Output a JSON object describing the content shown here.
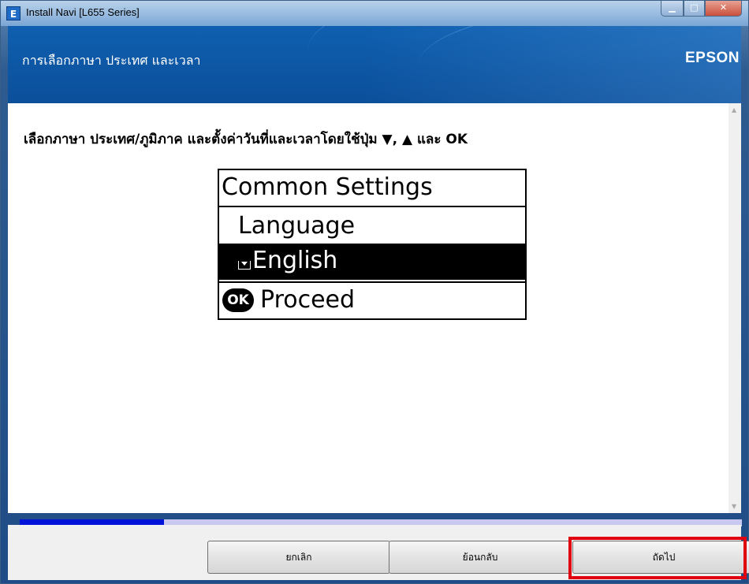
{
  "window": {
    "title": "Install Navi [L655 Series]",
    "app_icon_letter": "E"
  },
  "header": {
    "title": "การเลือกภาษา ประเทศ และเวลา",
    "brand": "EPSON"
  },
  "main": {
    "instruction": "เลือกภาษา ประเทศ/ภูมิภาค และตั้งค่าวันที่และเวลาโดยใช้ปุ่ม ▼, ▲ และ OK",
    "lcd": {
      "title": "Common Settings",
      "item_label": "Language",
      "selected_value": "English",
      "ok_badge": "OK",
      "action": "Proceed"
    }
  },
  "progress": {
    "value": 0.2,
    "fill_color": "#0013d8"
  },
  "footer": {
    "cancel_label": "ยกเลิก",
    "back_label": "ย้อนกลับ",
    "next_label": "ถัดไป",
    "highlight_color": "#e00010"
  }
}
